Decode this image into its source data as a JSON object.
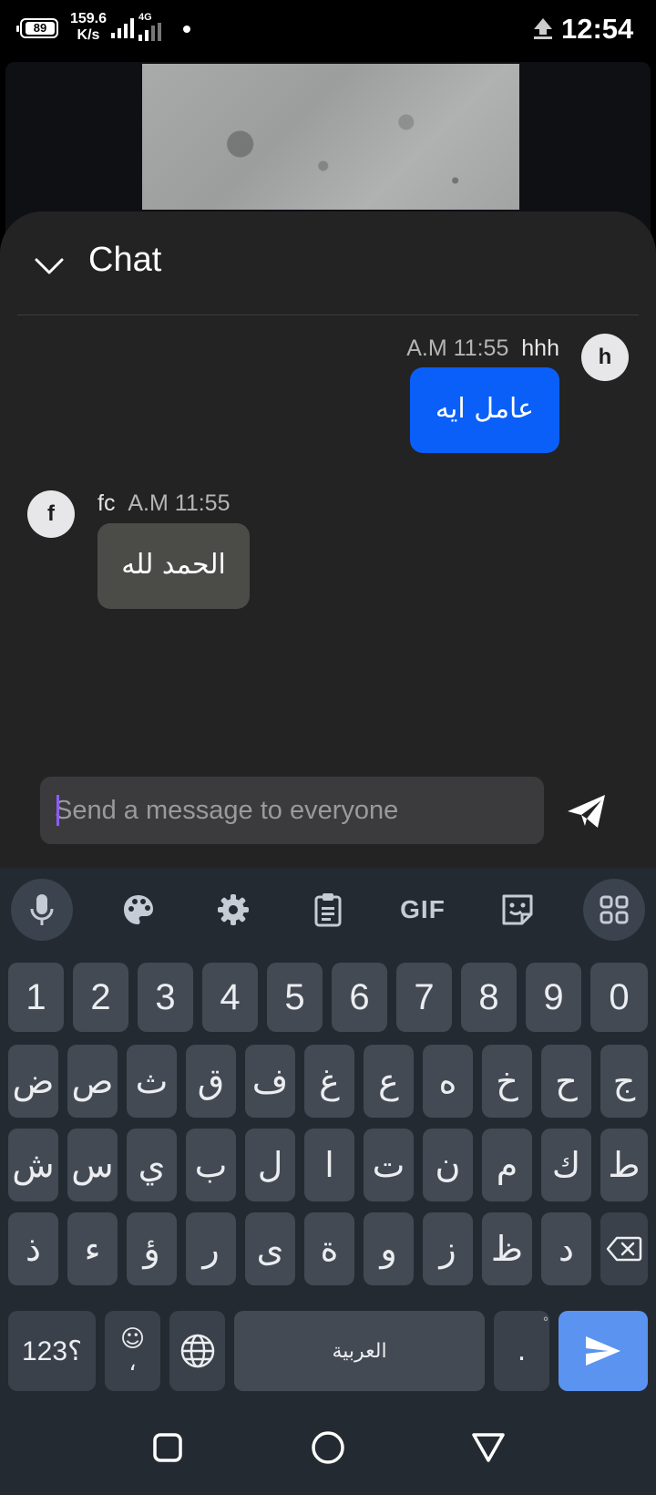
{
  "status_bar": {
    "battery": "89",
    "net_speed_value": "159.6",
    "net_speed_unit": "K/s",
    "network_type": "4G",
    "time": "12:54"
  },
  "chat": {
    "title": "Chat",
    "messages": [
      {
        "direction": "outgoing",
        "avatar_letter": "h",
        "sender": "hhh",
        "time": "11:55 A.M",
        "text": "عامل ايه"
      },
      {
        "direction": "incoming",
        "avatar_letter": "f",
        "sender": "fc",
        "time": "11:55 A.M",
        "text": "الحمد لله"
      }
    ],
    "composer_placeholder": "Send a message to everyone",
    "colors": {
      "outgoing_bubble": "#0a5ff8",
      "incoming_bubble": "#4b4c47"
    }
  },
  "keyboard": {
    "toolbar": [
      "mic-icon",
      "palette-icon",
      "gear-icon",
      "clipboard-icon",
      "GIF",
      "sticker-icon",
      "apps-grid-icon"
    ],
    "gif_label": "GIF",
    "number_row": [
      "1",
      "2",
      "3",
      "4",
      "5",
      "6",
      "7",
      "8",
      "9",
      "0"
    ],
    "row1": [
      "ض",
      "ص",
      "ث",
      "ق",
      "ف",
      "غ",
      "ع",
      "ه",
      "خ",
      "ح",
      "ج"
    ],
    "row2": [
      "ش",
      "س",
      "ي",
      "ب",
      "ل",
      "ا",
      "ت",
      "ن",
      "م",
      "ك",
      "ط"
    ],
    "row3": [
      "ذ",
      "ء",
      "ؤ",
      "ر",
      "ى",
      "ة",
      "و",
      "ز",
      "ظ",
      "د"
    ],
    "symbols_key": "؟123",
    "comma_key_top": "☺",
    "comma_key": "،",
    "space_label": "العربية",
    "period_key": ".",
    "period_superscript": "ْ",
    "accent": "#5b93f0"
  }
}
